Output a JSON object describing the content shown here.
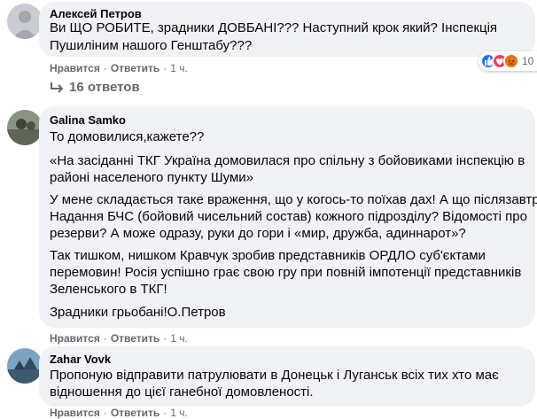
{
  "comments": [
    {
      "author": "Алексей Петров",
      "lines": [
        "Ви ЩО РОБИТЕ, зрадники ДОВБАНІ??? Наступний крок який? Інспекція",
        "Пушиліним нашого Генштабу???"
      ],
      "actions": {
        "like": "Нравится",
        "reply": "Ответить",
        "time": "1 ч."
      },
      "reaction_count": "10",
      "reaction_icons": [
        "like-icon",
        "love-icon",
        "angry-icon"
      ]
    },
    {
      "author": "Galina Samko",
      "lines": [
        "То домовилися,кажете??",
        "«На засіданні ТКГ Україна домовилася про спільну з бойовиками інспекцію в",
        "районі населеного пункту Шуми»",
        "У мене складається таке враження, що у когось-то поїхав дах! А що післязавтра?",
        "Надання БЧС (бойовий чисельний состав) кожного підрозділу? Відомості про",
        "резерви? А може одразу, руки до гори і «мир, дружба, адиннарот»?",
        "Так тишком, нишком Кравчук зробив представників ОРДЛО суб'єктами",
        "перемовин! Росія успішно грає свою гру при повній імпотенції представників",
        "Зеленського в ТКГ!",
        "Зрадники грьобані!О.Петров"
      ],
      "actions": {
        "like": "Нравится",
        "reply": "Ответить",
        "time": "1 ч."
      }
    },
    {
      "author": "Zahar Vovk",
      "lines": [
        "Пропоную відправити патрулювати в Донецьк і Луганськ всіх тих хто має",
        "відношення до цієї ганебної домовленості."
      ],
      "actions": {
        "like": "Нравится",
        "reply": "Ответить",
        "time": "1 ч."
      }
    }
  ],
  "replies_link": "16 ответов",
  "dot": "·"
}
